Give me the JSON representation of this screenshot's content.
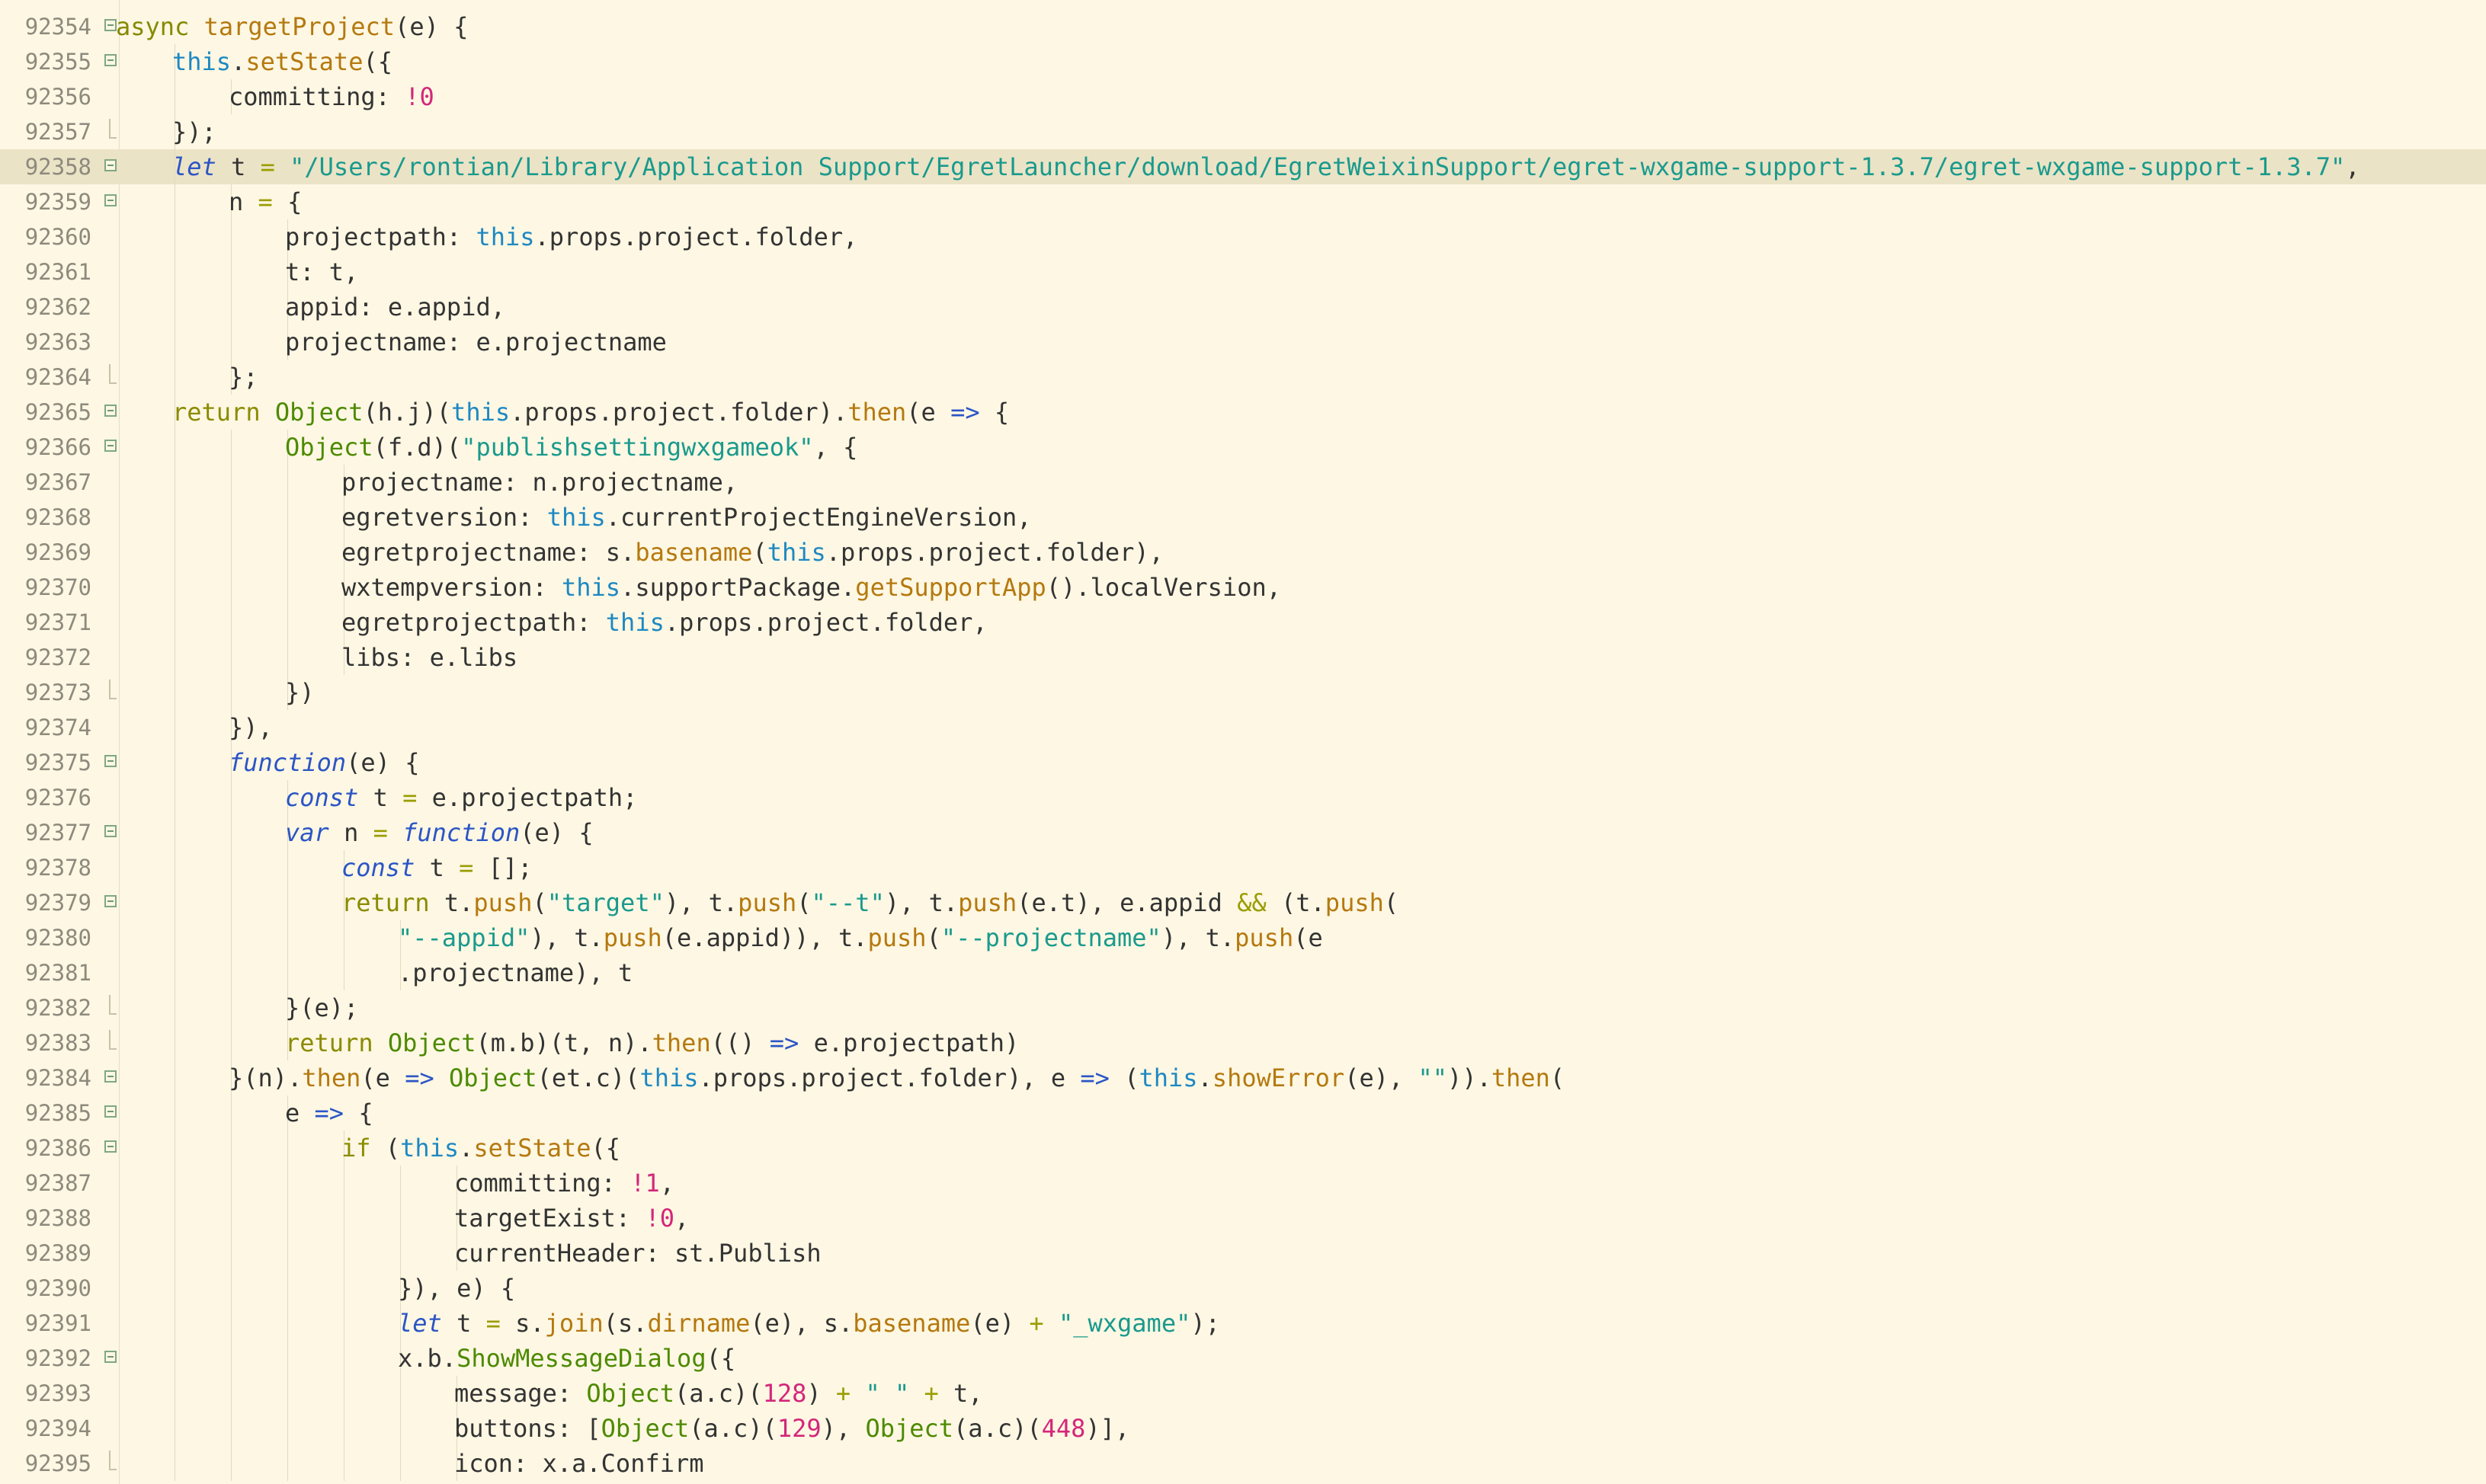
{
  "editor": {
    "lines": [
      {
        "n": "92354",
        "fold": "open",
        "indent": 1,
        "tokens": [
          [
            "kw",
            "async "
          ],
          [
            "method",
            "targetProject"
          ],
          [
            "plain",
            "(e) {"
          ]
        ]
      },
      {
        "n": "92355",
        "fold": "open",
        "indent": 2,
        "tokens": [
          [
            "this",
            "this"
          ],
          [
            "plain",
            "."
          ],
          [
            "method",
            "setState"
          ],
          [
            "plain",
            "({"
          ]
        ]
      },
      {
        "n": "92356",
        "fold": "none",
        "indent": 3,
        "tokens": [
          [
            "plain",
            "committing: "
          ],
          [
            "neg",
            "!"
          ],
          [
            "num",
            "0"
          ]
        ]
      },
      {
        "n": "92357",
        "fold": "end",
        "indent": 2,
        "tokens": [
          [
            "plain",
            "});"
          ]
        ]
      },
      {
        "n": "92358",
        "fold": "open",
        "indent": 2,
        "highlight": true,
        "tokens": [
          [
            "decl",
            "let"
          ],
          [
            "plain",
            " t "
          ],
          [
            "op",
            "="
          ],
          [
            "plain",
            " "
          ],
          [
            "str",
            "\"/Users/rontian/Library/Application Support/EgretLauncher/download/EgretWeixinSupport/egret-wxgame-support-1.3.7/egret-wxgame-support-1.3.7\""
          ],
          [
            "plain",
            ","
          ]
        ]
      },
      {
        "n": "92359",
        "fold": "open",
        "indent": 3,
        "tokens": [
          [
            "plain",
            "n "
          ],
          [
            "op",
            "="
          ],
          [
            "plain",
            " {"
          ]
        ]
      },
      {
        "n": "92360",
        "fold": "none",
        "indent": 4,
        "tokens": [
          [
            "plain",
            "projectpath: "
          ],
          [
            "this",
            "this"
          ],
          [
            "plain",
            ".props.project.folder,"
          ]
        ]
      },
      {
        "n": "92361",
        "fold": "none",
        "indent": 4,
        "tokens": [
          [
            "plain",
            "t: t,"
          ]
        ]
      },
      {
        "n": "92362",
        "fold": "none",
        "indent": 4,
        "tokens": [
          [
            "plain",
            "appid: e.appid,"
          ]
        ]
      },
      {
        "n": "92363",
        "fold": "none",
        "indent": 4,
        "tokens": [
          [
            "plain",
            "projectname: e.projectname"
          ]
        ]
      },
      {
        "n": "92364",
        "fold": "end",
        "indent": 3,
        "tokens": [
          [
            "plain",
            "};"
          ]
        ]
      },
      {
        "n": "92365",
        "fold": "open",
        "indent": 2,
        "tokens": [
          [
            "ret",
            "return "
          ],
          [
            "obj",
            "Object"
          ],
          [
            "plain",
            "(h.j)("
          ],
          [
            "this",
            "this"
          ],
          [
            "plain",
            ".props.project.folder)."
          ],
          [
            "method",
            "then"
          ],
          [
            "plain",
            "(e "
          ],
          [
            "arrow",
            "=>"
          ],
          [
            "plain",
            " {"
          ]
        ]
      },
      {
        "n": "92366",
        "fold": "open",
        "indent": 4,
        "tokens": [
          [
            "obj",
            "Object"
          ],
          [
            "plain",
            "(f.d)("
          ],
          [
            "str",
            "\"publishsettingwxgameok\""
          ],
          [
            "plain",
            ", {"
          ]
        ]
      },
      {
        "n": "92367",
        "fold": "none",
        "indent": 5,
        "tokens": [
          [
            "plain",
            "projectname: n.projectname,"
          ]
        ]
      },
      {
        "n": "92368",
        "fold": "none",
        "indent": 5,
        "tokens": [
          [
            "plain",
            "egretversion: "
          ],
          [
            "this",
            "this"
          ],
          [
            "plain",
            ".currentProjectEngineVersion,"
          ]
        ]
      },
      {
        "n": "92369",
        "fold": "none",
        "indent": 5,
        "tokens": [
          [
            "plain",
            "egretprojectname: s."
          ],
          [
            "method",
            "basename"
          ],
          [
            "plain",
            "("
          ],
          [
            "this",
            "this"
          ],
          [
            "plain",
            ".props.project.folder),"
          ]
        ]
      },
      {
        "n": "92370",
        "fold": "none",
        "indent": 5,
        "tokens": [
          [
            "plain",
            "wxtempversion: "
          ],
          [
            "this",
            "this"
          ],
          [
            "plain",
            ".supportPackage."
          ],
          [
            "method",
            "getSupportApp"
          ],
          [
            "plain",
            "().localVersion,"
          ]
        ]
      },
      {
        "n": "92371",
        "fold": "none",
        "indent": 5,
        "tokens": [
          [
            "plain",
            "egretprojectpath: "
          ],
          [
            "this",
            "this"
          ],
          [
            "plain",
            ".props.project.folder,"
          ]
        ]
      },
      {
        "n": "92372",
        "fold": "none",
        "indent": 5,
        "tokens": [
          [
            "plain",
            "libs: e.libs"
          ]
        ]
      },
      {
        "n": "92373",
        "fold": "end",
        "indent": 4,
        "tokens": [
          [
            "plain",
            "})"
          ]
        ]
      },
      {
        "n": "92374",
        "fold": "none",
        "indent": 3,
        "tokens": [
          [
            "plain",
            "}),"
          ]
        ]
      },
      {
        "n": "92375",
        "fold": "open",
        "indent": 3,
        "tokens": [
          [
            "fn",
            "function"
          ],
          [
            "plain",
            "(e) {"
          ]
        ]
      },
      {
        "n": "92376",
        "fold": "none",
        "indent": 4,
        "tokens": [
          [
            "decl",
            "const"
          ],
          [
            "plain",
            " t "
          ],
          [
            "op",
            "="
          ],
          [
            "plain",
            " e.projectpath;"
          ]
        ]
      },
      {
        "n": "92377",
        "fold": "open",
        "indent": 4,
        "tokens": [
          [
            "decl",
            "var"
          ],
          [
            "plain",
            " n "
          ],
          [
            "op",
            "="
          ],
          [
            "plain",
            " "
          ],
          [
            "fn",
            "function"
          ],
          [
            "plain",
            "(e) {"
          ]
        ]
      },
      {
        "n": "92378",
        "fold": "none",
        "indent": 5,
        "tokens": [
          [
            "decl",
            "const"
          ],
          [
            "plain",
            " t "
          ],
          [
            "op",
            "="
          ],
          [
            "plain",
            " [];"
          ]
        ]
      },
      {
        "n": "92379",
        "fold": "open",
        "indent": 5,
        "tokens": [
          [
            "ret",
            "return "
          ],
          [
            "plain",
            "t."
          ],
          [
            "method",
            "push"
          ],
          [
            "plain",
            "("
          ],
          [
            "str",
            "\"target\""
          ],
          [
            "plain",
            "), t."
          ],
          [
            "method",
            "push"
          ],
          [
            "plain",
            "("
          ],
          [
            "str",
            "\"--t\""
          ],
          [
            "plain",
            "), t."
          ],
          [
            "method",
            "push"
          ],
          [
            "plain",
            "(e.t), e.appid "
          ],
          [
            "op",
            "&&"
          ],
          [
            "plain",
            " (t."
          ],
          [
            "method",
            "push"
          ],
          [
            "plain",
            "("
          ]
        ]
      },
      {
        "n": "92380",
        "fold": "none",
        "indent": 6,
        "tokens": [
          [
            "str",
            "\"--appid\""
          ],
          [
            "plain",
            "), t."
          ],
          [
            "method",
            "push"
          ],
          [
            "plain",
            "(e.appid)), t."
          ],
          [
            "method",
            "push"
          ],
          [
            "plain",
            "("
          ],
          [
            "str",
            "\"--projectname\""
          ],
          [
            "plain",
            "), t."
          ],
          [
            "method",
            "push"
          ],
          [
            "plain",
            "(e"
          ]
        ]
      },
      {
        "n": "92381",
        "fold": "none",
        "indent": 6,
        "tokens": [
          [
            "plain",
            ".projectname), t"
          ]
        ]
      },
      {
        "n": "92382",
        "fold": "end",
        "indent": 4,
        "tokens": [
          [
            "plain",
            "}(e);"
          ]
        ]
      },
      {
        "n": "92383",
        "fold": "end",
        "indent": 4,
        "tokens": [
          [
            "ret",
            "return "
          ],
          [
            "obj",
            "Object"
          ],
          [
            "plain",
            "(m.b)(t, n)."
          ],
          [
            "method",
            "then"
          ],
          [
            "plain",
            "(() "
          ],
          [
            "arrow",
            "=>"
          ],
          [
            "plain",
            " e.projectpath)"
          ]
        ]
      },
      {
        "n": "92384",
        "fold": "open",
        "indent": 3,
        "tokens": [
          [
            "plain",
            "}(n)."
          ],
          [
            "method",
            "then"
          ],
          [
            "plain",
            "(e "
          ],
          [
            "arrow",
            "=>"
          ],
          [
            "plain",
            " "
          ],
          [
            "obj",
            "Object"
          ],
          [
            "plain",
            "(et.c)("
          ],
          [
            "this",
            "this"
          ],
          [
            "plain",
            ".props.project.folder), e "
          ],
          [
            "arrow",
            "=>"
          ],
          [
            "plain",
            " ("
          ],
          [
            "this",
            "this"
          ],
          [
            "plain",
            "."
          ],
          [
            "method",
            "showError"
          ],
          [
            "plain",
            "(e), "
          ],
          [
            "str",
            "\"\""
          ],
          [
            "plain",
            "))."
          ],
          [
            "method",
            "then"
          ],
          [
            "plain",
            "("
          ]
        ]
      },
      {
        "n": "92385",
        "fold": "open",
        "indent": 4,
        "tokens": [
          [
            "plain",
            "e "
          ],
          [
            "arrow",
            "=>"
          ],
          [
            "plain",
            " {"
          ]
        ]
      },
      {
        "n": "92386",
        "fold": "open",
        "indent": 5,
        "tokens": [
          [
            "ret",
            "if "
          ],
          [
            "plain",
            "("
          ],
          [
            "this",
            "this"
          ],
          [
            "plain",
            "."
          ],
          [
            "method",
            "setState"
          ],
          [
            "plain",
            "({"
          ]
        ]
      },
      {
        "n": "92387",
        "fold": "none",
        "indent": 7,
        "tokens": [
          [
            "plain",
            "committing: "
          ],
          [
            "neg",
            "!"
          ],
          [
            "num",
            "1"
          ],
          [
            "plain",
            ","
          ]
        ]
      },
      {
        "n": "92388",
        "fold": "none",
        "indent": 7,
        "tokens": [
          [
            "plain",
            "targetExist: "
          ],
          [
            "neg",
            "!"
          ],
          [
            "num",
            "0"
          ],
          [
            "plain",
            ","
          ]
        ]
      },
      {
        "n": "92389",
        "fold": "none",
        "indent": 7,
        "tokens": [
          [
            "plain",
            "currentHeader: st.Publish"
          ]
        ]
      },
      {
        "n": "92390",
        "fold": "none",
        "indent": 6,
        "tokens": [
          [
            "plain",
            "}), e) {"
          ]
        ]
      },
      {
        "n": "92391",
        "fold": "none",
        "indent": 6,
        "tokens": [
          [
            "decl",
            "let"
          ],
          [
            "plain",
            " t "
          ],
          [
            "op",
            "="
          ],
          [
            "plain",
            " s."
          ],
          [
            "method",
            "join"
          ],
          [
            "plain",
            "(s."
          ],
          [
            "method",
            "dirname"
          ],
          [
            "plain",
            "(e), s."
          ],
          [
            "method",
            "basename"
          ],
          [
            "plain",
            "(e) "
          ],
          [
            "op",
            "+"
          ],
          [
            "plain",
            " "
          ],
          [
            "str",
            "\"_wxgame\""
          ],
          [
            "plain",
            ");"
          ]
        ]
      },
      {
        "n": "92392",
        "fold": "open",
        "indent": 6,
        "tokens": [
          [
            "plain",
            "x.b."
          ],
          [
            "obj",
            "ShowMessageDialog"
          ],
          [
            "plain",
            "({"
          ]
        ]
      },
      {
        "n": "92393",
        "fold": "none",
        "indent": 7,
        "tokens": [
          [
            "plain",
            "message: "
          ],
          [
            "obj",
            "Object"
          ],
          [
            "plain",
            "(a.c)("
          ],
          [
            "num",
            "128"
          ],
          [
            "plain",
            ") "
          ],
          [
            "op",
            "+"
          ],
          [
            "plain",
            " "
          ],
          [
            "str",
            "\" \""
          ],
          [
            "plain",
            " "
          ],
          [
            "op",
            "+"
          ],
          [
            "plain",
            " t,"
          ]
        ]
      },
      {
        "n": "92394",
        "fold": "none",
        "indent": 7,
        "tokens": [
          [
            "plain",
            "buttons: ["
          ],
          [
            "obj",
            "Object"
          ],
          [
            "plain",
            "(a.c)("
          ],
          [
            "num",
            "129"
          ],
          [
            "plain",
            "), "
          ],
          [
            "obj",
            "Object"
          ],
          [
            "plain",
            "(a.c)("
          ],
          [
            "num",
            "448"
          ],
          [
            "plain",
            ")],"
          ]
        ]
      },
      {
        "n": "92395",
        "fold": "end",
        "indent": 7,
        "tokens": [
          [
            "plain",
            "icon: x.a.Confirm"
          ]
        ]
      }
    ]
  }
}
